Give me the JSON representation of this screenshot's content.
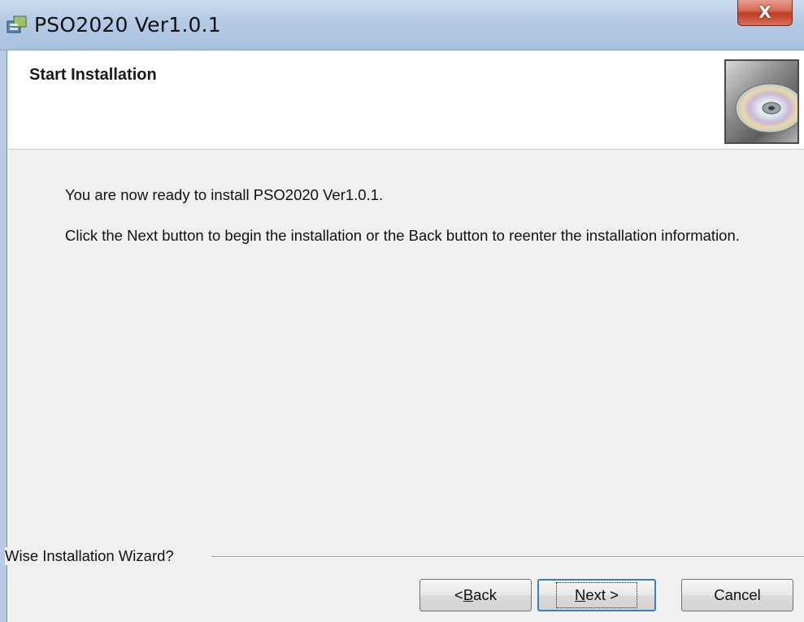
{
  "window": {
    "title": "PSO2020 Ver1.0.1",
    "close_glyph": "X",
    "icon": "installer-app-icon"
  },
  "header": {
    "title": "Start Installation",
    "graphic": "cd-disc-icon"
  },
  "content": {
    "ready_text": "You are now ready to install PSO2020 Ver1.0.1.",
    "instruction_text": "Click the Next button to begin the installation or the Back button to reenter the installation information."
  },
  "footer": {
    "group_label": "Wise Installation Wizard?"
  },
  "buttons": {
    "back_prefix": "< ",
    "back_accel": "B",
    "back_rest": "ack",
    "next_accel": "N",
    "next_rest": "ext",
    "next_suffix": " >",
    "cancel": "Cancel"
  },
  "colors": {
    "titlebar": "#b4c9e4",
    "close_button": "#c23b22",
    "dialog_bg": "#f0f0f0",
    "header_bg": "#ffffff",
    "focus_border": "#3c7fb1"
  }
}
